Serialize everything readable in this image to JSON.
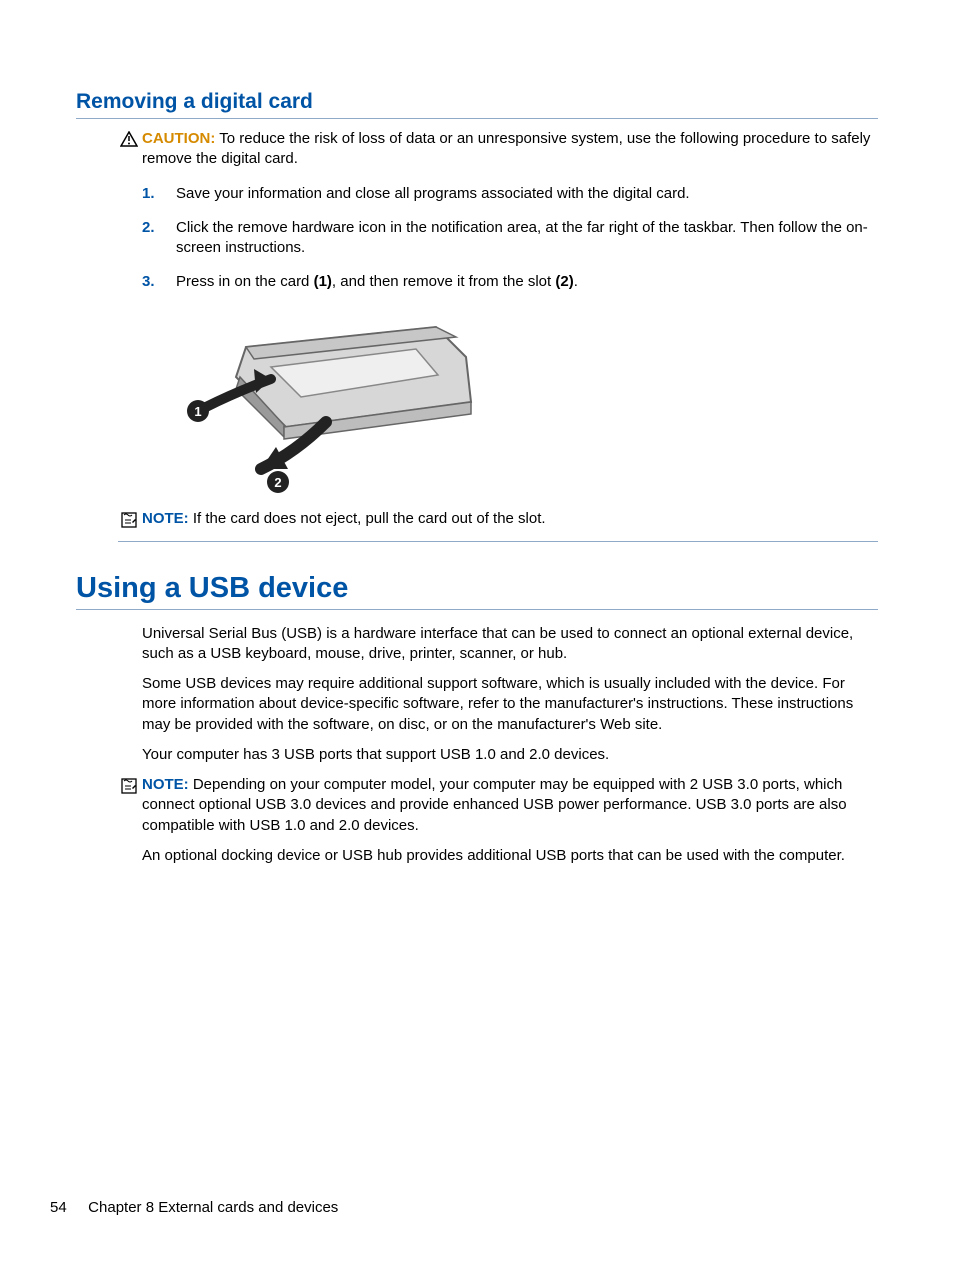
{
  "section1": {
    "heading": "Removing a digital card",
    "caution_label": "CAUTION:",
    "caution_text": " To reduce the risk of loss of data or an unresponsive system, use the following procedure to safely remove the digital card.",
    "steps": [
      {
        "n": "1.",
        "text": "Save your information and close all programs associated with the digital card."
      },
      {
        "n": "2.",
        "text": "Click the remove hardware icon in the notification area, at the far right of the taskbar. Then follow the on-screen instructions."
      },
      {
        "n": "3.",
        "pre": "Press in on the card ",
        "b1": "(1)",
        "mid": ", and then remove it from the slot ",
        "b2": "(2)",
        "post": "."
      }
    ],
    "note_label": "NOTE:",
    "note_text": " If the card does not eject, pull the card out of the slot."
  },
  "section2": {
    "heading": "Using a USB device",
    "p1": "Universal Serial Bus (USB) is a hardware interface that can be used to connect an optional external device, such as a USB keyboard, mouse, drive, printer, scanner, or hub.",
    "p2": "Some USB devices may require additional support software, which is usually included with the device. For more information about device-specific software, refer to the manufacturer's instructions. These instructions may be provided with the software, on disc, or on the manufacturer's Web site.",
    "p3": "Your computer has 3 USB ports that support USB 1.0 and 2.0 devices.",
    "note_label": "NOTE:",
    "note_text": " Depending on your computer model, your computer may be equipped with 2 USB 3.0 ports, which connect optional USB 3.0 devices and provide enhanced USB power performance. USB 3.0 ports are also compatible with USB 1.0 and 2.0 devices.",
    "p4": "An optional docking device or USB hub provides additional USB ports that can be used with the computer."
  },
  "footer": {
    "page": "54",
    "chapter": "Chapter 8   External cards and devices"
  }
}
